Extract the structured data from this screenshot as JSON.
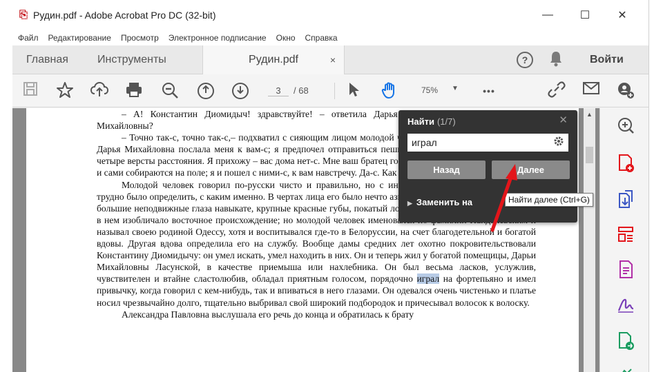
{
  "window": {
    "title": "Рудин.pdf - Adobe Acrobat Pro DC (32-bit)",
    "minimize": "—",
    "maximize": "☐",
    "close": "✕"
  },
  "menu": [
    "Файл",
    "Редактирование",
    "Просмотр",
    "Электронное подписание",
    "Окно",
    "Справка"
  ],
  "tabs": {
    "home": "Главная",
    "tools": "Инструменты",
    "document": "Рудин.pdf",
    "document_close": "×"
  },
  "header": {
    "help": "?",
    "signin": "Войти"
  },
  "toolbar": {
    "current_page": "3",
    "total_pages": "/ 68",
    "zoom": "75%",
    "more": "•••"
  },
  "document": {
    "paragraphs": [
      "– А! Константин Диомидыч! здравствуйте! – ответила Дарья Михайловна. – Вы от Дарьи Михайловны?",
      "– Точно так-с, точно так-с,– подхватил с сияющим лицом молодой человек, – от Дарьи Михайловны. Дарья Михайловна послала меня к вам-с; я предпочел отправиться пешком... Утро такое чудесное, всего четыре версты расстояния. Я прихожу – вас дома нет-с. Мне ваш братец говорит, что вы пошли в Семеновку, и сами собираются на поле; я и пошел с ними-с, к вам навстречу. Да-с. Как это приятно!",
      "Молодой человек говорил по-русски чисто и правильно, но с иностранным произношением, хотя трудно было определить, с каким именно. В чертах лица его было нечто азиатское. Длинный нос с горбиной, большие неподвижные глаза навыкате, крупные красные губы, покатый лоб, черные как смоль волосы – все в нем изобличало восточное происхождение; но молодой человек именовался по фамилии Пандалевским и называл своею родиной Одессу, хотя и воспитывался где-то в Белоруссии, на счет благодетельной и богатой вдовы. Другая вдова определила его на службу. Вообще дамы средних лет охотно покровительствовали Константину Диомидычу: он умел искать, умел находить в них. Он и теперь жил у богатой помещицы, Дарьи Михайловны Ласунской, в качестве приемыша или нахлебника. Он был весьма ласков, услужлив, чувствителен и втайне сластолюбив, обладал приятным голосом, порядочно ",
      "Александра Павловна выслушала его речь до конца и обратилась к брату"
    ],
    "highlight": "играл",
    "after_highlight": " на фортепьяно и имел привычку, когда говорил с кем-нибудь, так и впиваться в него глазами. Он одевался очень чистенько и платье носил чрезвычайно долго, тщательно выбривал свой широкий подбородок и причесывал волосок к волоску."
  },
  "find": {
    "title": "Найти",
    "count": "(1/7)",
    "close": "✕",
    "query": "играл",
    "prev": "Назад",
    "next": "Далее",
    "replace": "Заменить на"
  },
  "tooltip": "Найти далее (Ctrl+G)",
  "colors": {
    "accent_red": "#e3151a",
    "find_bg": "#333333",
    "highlight": "#b7cbe6"
  }
}
